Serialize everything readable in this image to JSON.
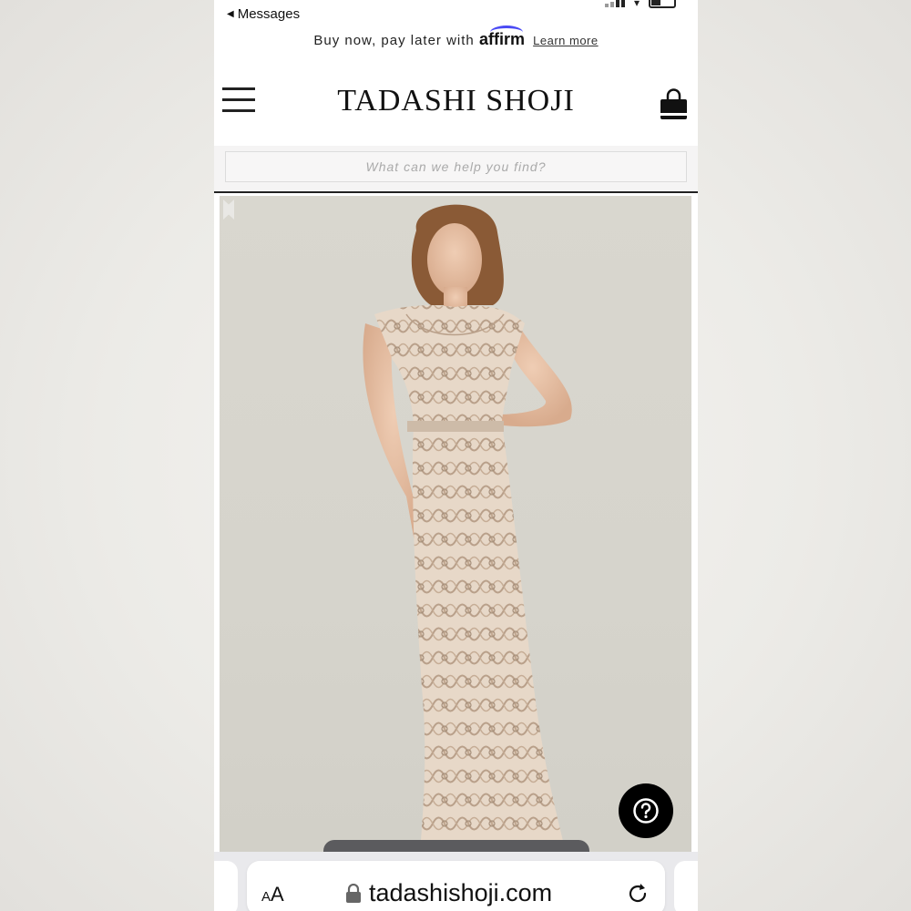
{
  "status_bar": {
    "back_label": "Messages"
  },
  "banner": {
    "text": "Buy now, pay later with",
    "brand": "affirm",
    "link": "Learn more"
  },
  "header": {
    "brand": "TADASHI SHOJI",
    "menu_icon": "hamburger-menu-icon",
    "bag_icon": "shopping-bag-icon"
  },
  "search": {
    "placeholder": "What can we help you find?"
  },
  "gallery": {
    "image_subject": "model wearing champagne lace gown",
    "prev_icon": "chevron-left-icon",
    "next_icon": "chevron-right-icon"
  },
  "help": {
    "icon": "question-mark-icon"
  },
  "browser": {
    "text_size_label_small": "A",
    "text_size_label_big": "A",
    "url": "tadashishoji.com",
    "lock_icon": "lock-icon",
    "reload_icon": "reload-icon"
  },
  "colors": {
    "background": "#ffffff",
    "search_bg": "#f5f4f4",
    "image_bg": "#d8d6ce",
    "help_button": "#000000",
    "affirm_blue": "#4a4af4",
    "dress": "#d9c6b3"
  }
}
